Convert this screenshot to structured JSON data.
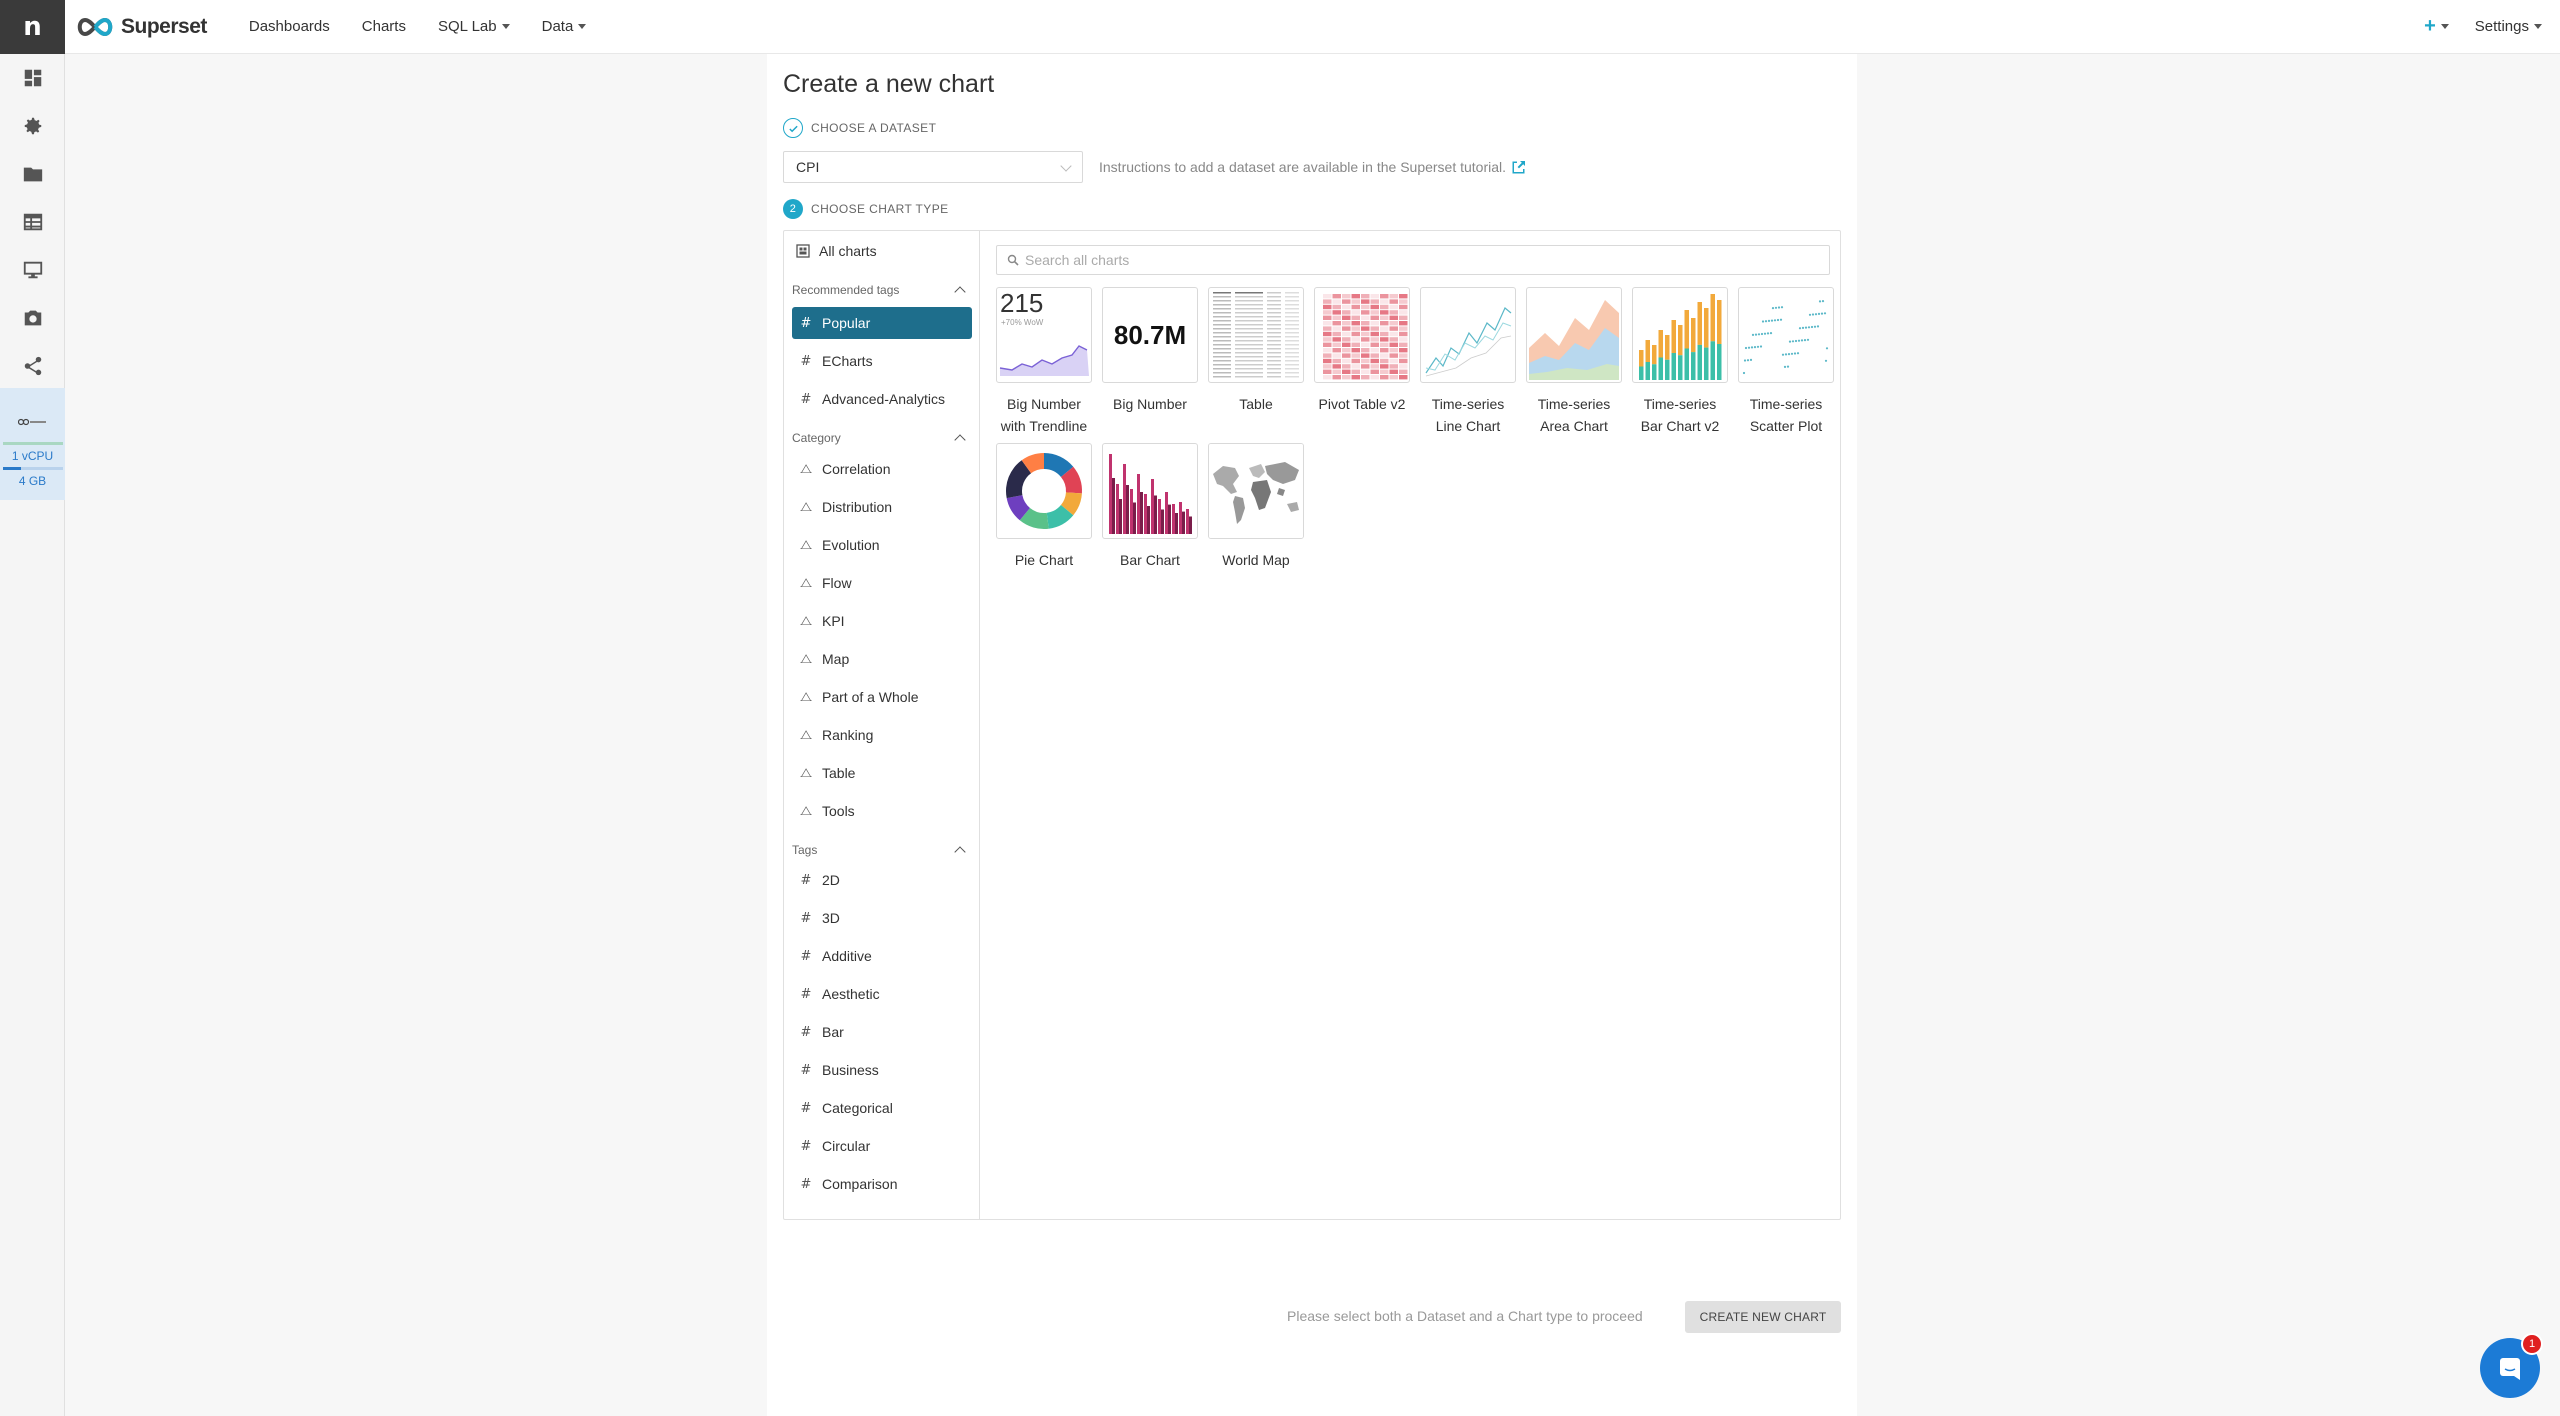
{
  "rail": {
    "logo": "n",
    "icons": [
      "dashboard-icon",
      "gear-icon",
      "folder-icon",
      "table-icon",
      "monitor-icon",
      "camera-icon",
      "share-icon"
    ],
    "usage": {
      "cpu": "1 vCPU",
      "mem": "4 GB",
      "mem_fraction": 0.3
    }
  },
  "nav": {
    "brand": "Superset",
    "items": [
      {
        "label": "Dashboards",
        "dropdown": false
      },
      {
        "label": "Charts",
        "dropdown": false
      },
      {
        "label": "SQL Lab",
        "dropdown": true
      },
      {
        "label": "Data",
        "dropdown": true
      }
    ],
    "plus": "+",
    "settings": "Settings"
  },
  "page": {
    "title": "Create a new chart",
    "step1": "CHOOSE A DATASET",
    "step2_num": "2",
    "step2": "CHOOSE CHART TYPE",
    "dataset_value": "CPI",
    "instructions": "Instructions to add a dataset are available in the Superset tutorial.",
    "footer_msg": "Please select both a Dataset and a Chart type to proceed",
    "create_button": "CREATE NEW CHART"
  },
  "picker": {
    "all_charts": "All charts",
    "recommended_title": "Recommended tags",
    "recommended": [
      "Popular",
      "ECharts",
      "Advanced-Analytics"
    ],
    "category_title": "Category",
    "categories": [
      "Correlation",
      "Distribution",
      "Evolution",
      "Flow",
      "KPI",
      "Map",
      "Part of a Whole",
      "Ranking",
      "Table",
      "Tools"
    ],
    "tags_title": "Tags",
    "tags": [
      "2D",
      "3D",
      "Additive",
      "Aesthetic",
      "Bar",
      "Business",
      "Categorical",
      "Circular",
      "Comparison"
    ],
    "search_placeholder": "Search all charts",
    "charts": [
      {
        "label": "Big Number with Trendline",
        "thumb": "big-number-trendline",
        "value": "215",
        "sub": "+70% WoW"
      },
      {
        "label": "Big Number",
        "thumb": "big-number",
        "value": "80.7M"
      },
      {
        "label": "Table",
        "thumb": "table"
      },
      {
        "label": "Pivot Table v2",
        "thumb": "pivot"
      },
      {
        "label": "Time-series Line Chart",
        "thumb": "line"
      },
      {
        "label": "Time-series Area Chart",
        "thumb": "area"
      },
      {
        "label": "Time-series Bar Chart v2",
        "thumb": "bar-ts"
      },
      {
        "label": "Time-series Scatter Plot",
        "thumb": "scatter"
      },
      {
        "label": "Pie Chart",
        "thumb": "pie"
      },
      {
        "label": "Bar Chart",
        "thumb": "bar"
      },
      {
        "label": "World Map",
        "thumb": "map"
      }
    ]
  },
  "chat": {
    "badge": "1"
  },
  "colors": {
    "accent": "#20a7c9",
    "active_tag": "#1e6e8c",
    "brand_dark": "#3a3a3a"
  }
}
